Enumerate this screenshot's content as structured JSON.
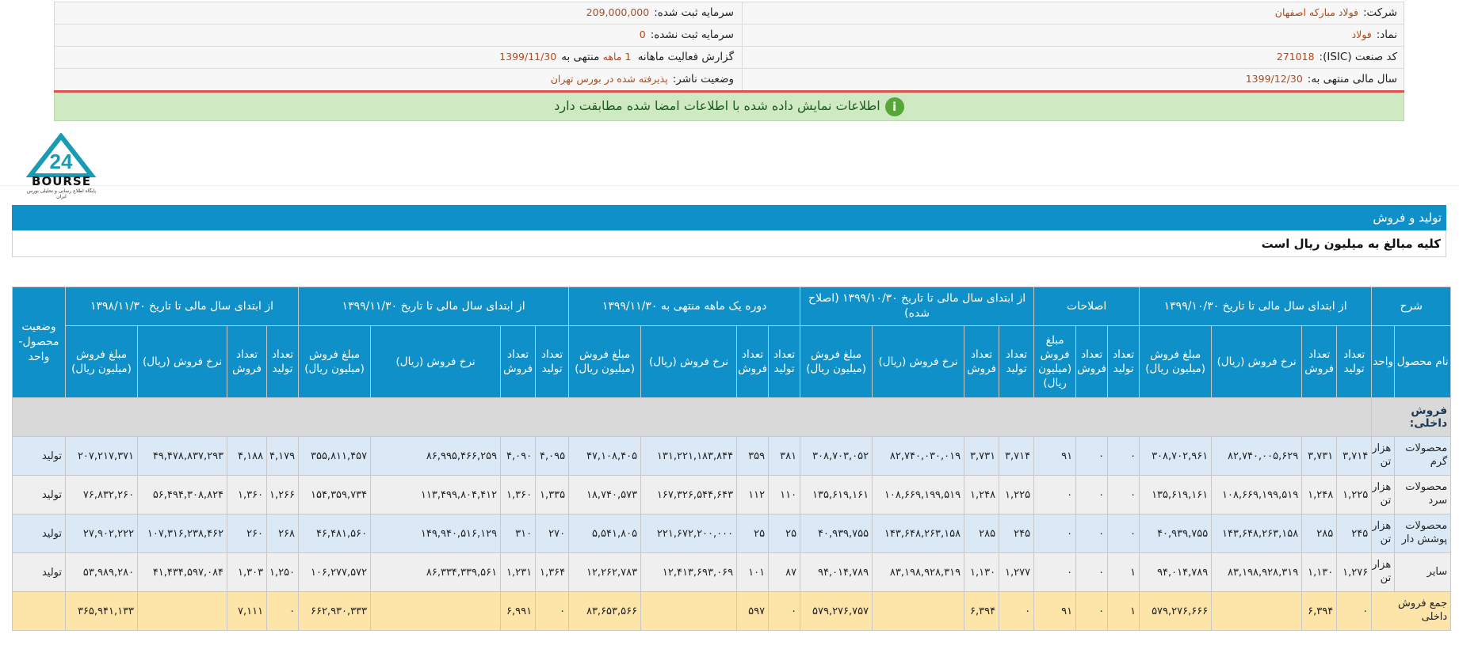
{
  "company_info": {
    "right": [
      {
        "label": "شرکت:",
        "value": "فولاد مبارکه اصفهان"
      },
      {
        "label": "نماد:",
        "value": "فولاد"
      },
      {
        "label": "کد صنعت (ISIC):",
        "value": "271018"
      },
      {
        "label": "سال مالی منتهی به:",
        "value": "1399/12/30"
      }
    ],
    "left": [
      {
        "label": "سرمایه ثبت شده:",
        "value": "209,000,000"
      },
      {
        "label": "سرمایه ثبت نشده:",
        "value": "0"
      },
      {
        "label": "گزارش فعالیت ماهانه",
        "value_prefix": "1 ماهه",
        "value_mid": "منتهی به",
        "value": "1399/11/30"
      },
      {
        "label": "وضعیت ناشر:",
        "value": "پذیرفته شده در بورس تهران"
      }
    ]
  },
  "notice": {
    "text": "اطلاعات نمایش داده شده با اطلاعات امضا شده مطابقت دارد",
    "icon": "info-icon",
    "icon_glyph": "i"
  },
  "logo": {
    "text": "BOURSE",
    "subtitle": "پایگاه اطلاع رسانی و تحلیلی بورس ایران"
  },
  "section_title": "تولید و فروش",
  "section_note": "کلیه مبالغ به میلیون ریال است",
  "table": {
    "top_headers": [
      "شرح",
      "از ابتدای سال مالی تا تاریخ ۱۳۹۹/۱۰/۳۰",
      "اصلاحات",
      "از ابتدای سال مالی تا تاریخ ۱۳۹۹/۱۰/۳۰ (اصلاح شده)",
      "دوره یک ماهه منتهی به ۱۳۹۹/۱۱/۳۰",
      "از ابتدای سال مالی تا تاریخ ۱۳۹۹/۱۱/۳۰",
      "از ابتدای سال مالی تا تاریخ ۱۳۹۸/۱۱/۳۰",
      "وضعیت محصول-واحد"
    ],
    "sub_headers": {
      "name": "نام محصول",
      "unit": "واحد",
      "prod": "تعداد تولید",
      "sales": "تعداد فروش",
      "rate": "نرخ فروش (ریال)",
      "amount": "مبلغ فروش (میلیون ریال)",
      "corr_prod": "تعداد تولید",
      "corr_sales": "تعداد فروش",
      "corr_amount": "مبلغ فروش (میلیون ریال)"
    },
    "section_label": "فروش داخلی:",
    "rows": [
      {
        "name": "محصولات گرم",
        "unit": "هزار تن",
        "p1": [
          "۳,۷۱۴",
          "۳,۷۳۱",
          "۸۲,۷۴۰,۰۰۵,۶۲۹",
          "۳۰۸,۷۰۲,۹۶۱"
        ],
        "corr": [
          "۰",
          "۰",
          "۹۱"
        ],
        "p2": [
          "۳,۷۱۴",
          "۳,۷۳۱",
          "۸۲,۷۴۰,۰۳۰,۰۱۹",
          "۳۰۸,۷۰۳,۰۵۲"
        ],
        "p3": [
          "۳۸۱",
          "۳۵۹",
          "۱۳۱,۲۲۱,۱۸۳,۸۴۴",
          "۴۷,۱۰۸,۴۰۵"
        ],
        "p4": [
          "۴,۰۹۵",
          "۴,۰۹۰",
          "۸۶,۹۹۵,۴۶۶,۲۵۹",
          "۳۵۵,۸۱۱,۴۵۷"
        ],
        "p5": [
          "۴,۱۷۹",
          "۴,۱۸۸",
          "۴۹,۴۷۸,۸۳۷,۲۹۳",
          "۲۰۷,۲۱۷,۳۷۱"
        ],
        "status": "تولید"
      },
      {
        "name": "محصولات سرد",
        "unit": "هزار تن",
        "p1": [
          "۱,۲۲۵",
          "۱,۲۴۸",
          "۱۰۸,۶۶۹,۱۹۹,۵۱۹",
          "۱۳۵,۶۱۹,۱۶۱"
        ],
        "corr": [
          "۰",
          "۰",
          "۰"
        ],
        "p2": [
          "۱,۲۲۵",
          "۱,۲۴۸",
          "۱۰۸,۶۶۹,۱۹۹,۵۱۹",
          "۱۳۵,۶۱۹,۱۶۱"
        ],
        "p3": [
          "۱۱۰",
          "۱۱۲",
          "۱۶۷,۳۲۶,۵۴۴,۶۴۳",
          "۱۸,۷۴۰,۵۷۳"
        ],
        "p4": [
          "۱,۳۳۵",
          "۱,۳۶۰",
          "۱۱۳,۴۹۹,۸۰۴,۴۱۲",
          "۱۵۴,۳۵۹,۷۳۴"
        ],
        "p5": [
          "۱,۲۶۶",
          "۱,۳۶۰",
          "۵۶,۴۹۴,۳۰۸,۸۲۴",
          "۷۶,۸۳۲,۲۶۰"
        ],
        "status": "تولید"
      },
      {
        "name": "محصولات پوشش دار",
        "unit": "هزار تن",
        "p1": [
          "۲۴۵",
          "۲۸۵",
          "۱۴۳,۶۴۸,۲۶۳,۱۵۸",
          "۴۰,۹۳۹,۷۵۵"
        ],
        "corr": [
          "۰",
          "۰",
          "۰"
        ],
        "p2": [
          "۲۴۵",
          "۲۸۵",
          "۱۴۳,۶۴۸,۲۶۳,۱۵۸",
          "۴۰,۹۳۹,۷۵۵"
        ],
        "p3": [
          "۲۵",
          "۲۵",
          "۲۲۱,۶۷۲,۲۰۰,۰۰۰",
          "۵,۵۴۱,۸۰۵"
        ],
        "p4": [
          "۲۷۰",
          "۳۱۰",
          "۱۴۹,۹۴۰,۵۱۶,۱۲۹",
          "۴۶,۴۸۱,۵۶۰"
        ],
        "p5": [
          "۲۶۸",
          "۲۶۰",
          "۱۰۷,۳۱۶,۲۳۸,۴۶۲",
          "۲۷,۹۰۲,۲۲۲"
        ],
        "status": "تولید"
      },
      {
        "name": "سایر",
        "unit": "هزار تن",
        "p1": [
          "۱,۲۷۶",
          "۱,۱۳۰",
          "۸۳,۱۹۸,۹۲۸,۳۱۹",
          "۹۴,۰۱۴,۷۸۹"
        ],
        "corr": [
          "۱",
          "۰",
          "۰"
        ],
        "p2": [
          "۱,۲۷۷",
          "۱,۱۳۰",
          "۸۳,۱۹۸,۹۲۸,۳۱۹",
          "۹۴,۰۱۴,۷۸۹"
        ],
        "p3": [
          "۸۷",
          "۱۰۱",
          "۱۲,۴۱۳,۶۹۳,۰۶۹",
          "۱۲,۲۶۲,۷۸۳"
        ],
        "p4": [
          "۱,۳۶۴",
          "۱,۲۳۱",
          "۸۶,۳۳۴,۳۳۹,۵۶۱",
          "۱۰۶,۲۷۷,۵۷۲"
        ],
        "p5": [
          "۱,۲۵۰",
          "۱,۳۰۳",
          "۴۱,۴۳۴,۵۹۷,۰۸۴",
          "۵۳,۹۸۹,۲۸۰"
        ],
        "status": "تولید"
      }
    ],
    "total": {
      "label": "جمع فروش داخلی",
      "p1": [
        "۰",
        "۶,۳۹۴",
        "",
        "۵۷۹,۲۷۶,۶۶۶"
      ],
      "corr": [
        "۱",
        "۰",
        "۹۱"
      ],
      "p2": [
        "۰",
        "۶,۳۹۴",
        "",
        "۵۷۹,۲۷۶,۷۵۷"
      ],
      "p3": [
        "۰",
        "۵۹۷",
        "",
        "۸۳,۶۵۳,۵۶۶"
      ],
      "p4": [
        "۰",
        "۶,۹۹۱",
        "",
        "۶۶۲,۹۳۰,۳۳۳"
      ],
      "p5": [
        "۰",
        "۷,۱۱۱",
        "",
        "۳۶۵,۹۴۱,۱۳۳"
      ],
      "status": ""
    }
  }
}
